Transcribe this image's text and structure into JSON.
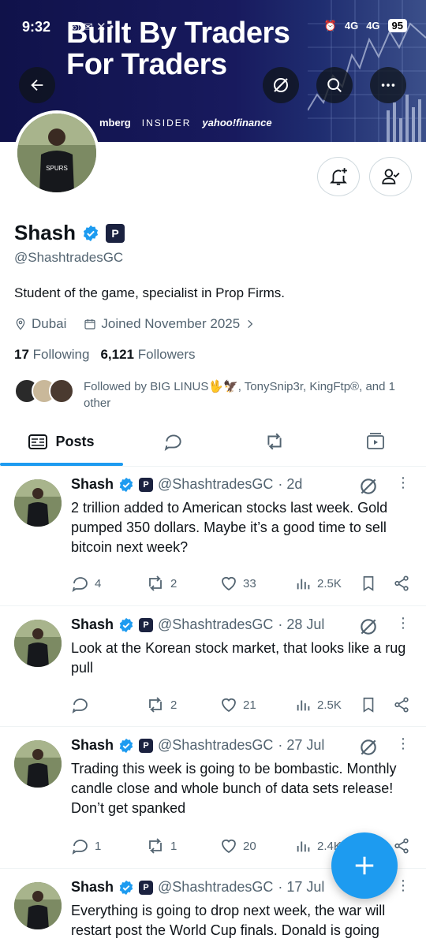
{
  "status": {
    "time": "9:32",
    "network1": "4G",
    "network2": "4G",
    "battery": "95"
  },
  "banner": {
    "title_line1": "Built By Traders",
    "title_line2": "For Traders",
    "logos": [
      "mberg",
      "INSIDER",
      "yahoo!finance"
    ]
  },
  "profile": {
    "name": "Shash",
    "handle": "@ShashtradesGC",
    "bio": "Student of the game, specialist in Prop Firms.",
    "location": "Dubai",
    "joined": "Joined November 2025",
    "following_count": "17",
    "following_label": "Following",
    "followers_count": "6,121",
    "followers_label": "Followers",
    "followed_by": "Followed by BIG LINUS🖖🦅, TonySnip3r, KingFtp®, and 1 other"
  },
  "tabs": {
    "posts": "Posts"
  },
  "colors": {
    "accent": "#1d9bf0",
    "banner": "#181a5e"
  },
  "posts": [
    {
      "name": "Shash",
      "handle": "@ShashtradesGC",
      "time": "· 2d",
      "text": "2 trillion added to American stocks last week. Gold pumped 350 dollars. Maybe it’s a good time to sell bitcoin next week?",
      "replies": "4",
      "reposts": "2",
      "likes": "33",
      "views": "2.5K"
    },
    {
      "name": "Shash",
      "handle": "@ShashtradesGC",
      "time": "· 28 Jul",
      "text": "Look at the Korean stock market, that looks like a rug pull",
      "replies": "",
      "reposts": "2",
      "likes": "21",
      "views": "2.5K"
    },
    {
      "name": "Shash",
      "handle": "@ShashtradesGC",
      "time": "· 27 Jul",
      "text": "Trading this week is going to be bombastic. Monthly candle close and whole bunch of data sets release! Don’t get spanked",
      "replies": "1",
      "reposts": "1",
      "likes": "20",
      "views": "2.4K"
    },
    {
      "name": "Shash",
      "handle": "@ShashtradesGC",
      "time": "· 17 Jul",
      "text": "Everything is going to drop next week, the war will restart post the World Cup finals. Donald is going"
    }
  ]
}
